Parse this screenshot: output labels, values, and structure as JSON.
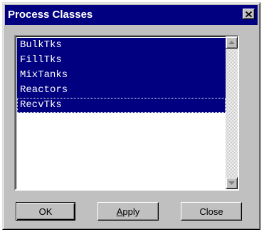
{
  "window": {
    "title": "Process Classes",
    "close_glyph": "×"
  },
  "list": {
    "items": [
      {
        "label": "BulkTks",
        "selected": true
      },
      {
        "label": "FillTks",
        "selected": true
      },
      {
        "label": "MixTanks",
        "selected": true
      },
      {
        "label": "Reactors",
        "selected": true
      },
      {
        "label": "RecvTks",
        "selected": true,
        "focused": true
      }
    ]
  },
  "scrollbar": {
    "up_icon": "arrow-up-icon",
    "down_icon": "arrow-down-icon"
  },
  "buttons": {
    "ok_label": "OK",
    "apply_label": "Apply",
    "apply_accel": "A",
    "apply_rest": "pply",
    "close_label": "Close"
  },
  "colors": {
    "title_bar": "#000080",
    "selection": "#000080",
    "face": "#c0c0c0"
  }
}
